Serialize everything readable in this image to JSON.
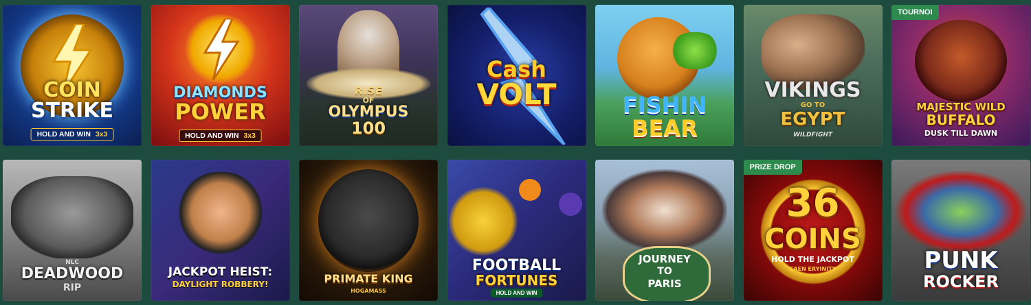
{
  "games": [
    {
      "title": "COIN STRIKE",
      "line1": "COIN",
      "line2": "STRIKE",
      "subtitle": "HOLD AND WIN",
      "extra": "3x3",
      "icon": "lightning-bolt-icon"
    },
    {
      "title": "DIAMONDS POWER",
      "line1": "DIAMONDS",
      "line2": "POWER",
      "subtitle": "HOLD AND WIN",
      "extra": "3x3",
      "icon": "lightning-bolt-icon"
    },
    {
      "title": "RISE OF OLYMPUS 100",
      "line1": "RISE",
      "line2": "OF",
      "line3": "OLYMPUS",
      "line4": "100",
      "icon": "zeus-figure"
    },
    {
      "title": "Cash VOLT",
      "line1": "Cash",
      "line2": "VOLT",
      "icon": "lightning-bolt-icon"
    },
    {
      "title": "FISHIN BEAR",
      "line1": "FISHIN",
      "line2": "BEAR",
      "icon": "bear-mascot"
    },
    {
      "title": "VIKINGS GO TO EGYPT",
      "line1": "VIKINGS",
      "line2": "GO TO",
      "line3": "EGYPT",
      "provider": "WILDFIGHT",
      "icon": "vikings-figures"
    },
    {
      "title": "MAJESTIC WILD BUFFALO",
      "line1": "MAJESTIC WILD",
      "line2": "BUFFALO",
      "subtitle": "DUSK TILL DAWN",
      "badge": "TOURNOI",
      "icon": "buffalo-head"
    },
    {
      "title": "DEADWOOD R.I.P",
      "line1": "NLC",
      "line2": "DEADWOOD",
      "line3": "RIP",
      "icon": "cowboy-figures"
    },
    {
      "title": "JACKPOT HEIST: DAYLIGHT ROBBERY!",
      "line1": "JACKPOT HEIST:",
      "line2": "DAYLIGHT ROBBERY!",
      "icon": "robber-mugshot"
    },
    {
      "title": "PRIMATE KING",
      "line1": "PRIMATE KING",
      "provider": "HOGAMASS",
      "icon": "gorilla"
    },
    {
      "title": "FOOTBALL FORTUNES",
      "line1": "FOOTBALL",
      "line2": "FORTUNES",
      "subtitle": "HOLD AND WIN",
      "icon": "football-fruits"
    },
    {
      "title": "JOURNEY TO PARIS",
      "line1": "JOURNEY",
      "line2": "TO",
      "line3": "PARIS",
      "icon": "mime-characters"
    },
    {
      "title": "36 COINS",
      "line1": "36",
      "line2": "COINS",
      "subtitle": "HOLD THE JACKPOT",
      "tag": "CAEN ERYINITY",
      "badge": "PRIZE DROP",
      "icon": "coin-ring"
    },
    {
      "title": "PUNK ROCKER",
      "line1": "PUNK",
      "line2": "ROCKER",
      "icon": "punk-characters"
    }
  ]
}
